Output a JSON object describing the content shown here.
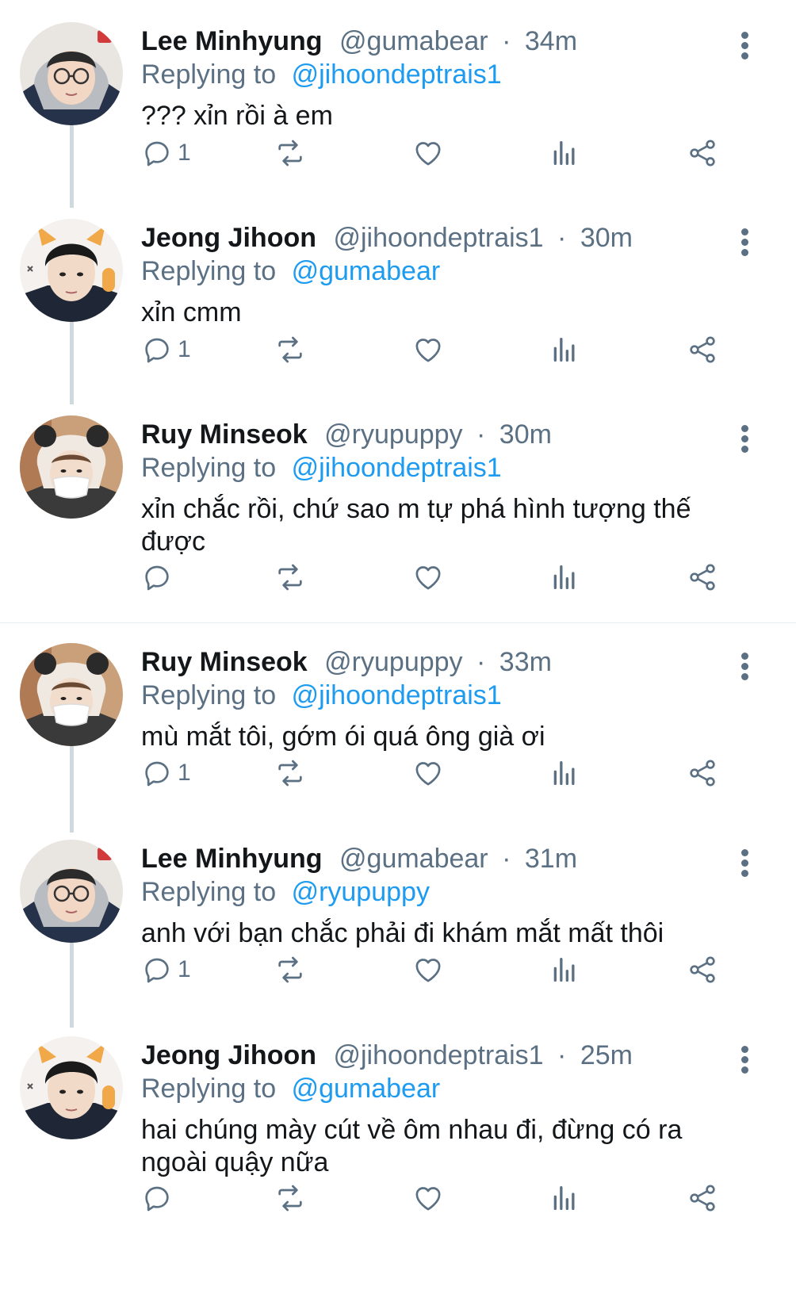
{
  "colors": {
    "accent": "#1d9bf0",
    "secondary_text": "#5b7083",
    "thread_line": "#cfd9de"
  },
  "tweets": [
    {
      "name": "Lee Minhyung",
      "handle": "@gumabear",
      "separator": "·",
      "time": "34m",
      "replying_prefix": "Replying to",
      "replying_to": "@jihoondeptrais1",
      "text": "??? xỉn rồi à em",
      "reply_count": "1",
      "avatar": "avatar-lee-minhyung-icon"
    },
    {
      "name": "Jeong Jihoon",
      "handle": "@jihoondeptrais1",
      "separator": "·",
      "time": "30m",
      "replying_prefix": "Replying to",
      "replying_to": "@gumabear",
      "text": "xỉn cmm",
      "reply_count": "1",
      "avatar": "avatar-jeong-jihoon-icon"
    },
    {
      "name": "Ruy Minseok",
      "handle": "@ryupuppy",
      "separator": "·",
      "time": "30m",
      "replying_prefix": "Replying to",
      "replying_to": "@jihoondeptrais1",
      "text": "xỉn chắc rồi, chứ sao m tự phá hình tượng thế được",
      "reply_count": "",
      "avatar": "avatar-ruy-minseok-icon"
    },
    {
      "name": "Ruy Minseok",
      "handle": "@ryupuppy",
      "separator": "·",
      "time": "33m",
      "replying_prefix": "Replying to",
      "replying_to": "@jihoondeptrais1",
      "text": "mù mắt tôi, gớm ói quá ông già ơi",
      "reply_count": "1",
      "avatar": "avatar-ruy-minseok-icon"
    },
    {
      "name": "Lee Minhyung",
      "handle": "@gumabear",
      "separator": "·",
      "time": "31m",
      "replying_prefix": "Replying to",
      "replying_to": "@ryupuppy",
      "text": "anh với bạn chắc phải đi khám mắt mất thôi",
      "reply_count": "1",
      "avatar": "avatar-lee-minhyung-icon"
    },
    {
      "name": "Jeong Jihoon",
      "handle": "@jihoondeptrais1",
      "separator": "·",
      "time": "25m",
      "replying_prefix": "Replying to",
      "replying_to": "@gumabear",
      "text": "hai chúng mày cút về ôm nhau đi, đừng có ra ngoài quậy nữa",
      "reply_count": "",
      "avatar": "avatar-jeong-jihoon-icon"
    }
  ]
}
